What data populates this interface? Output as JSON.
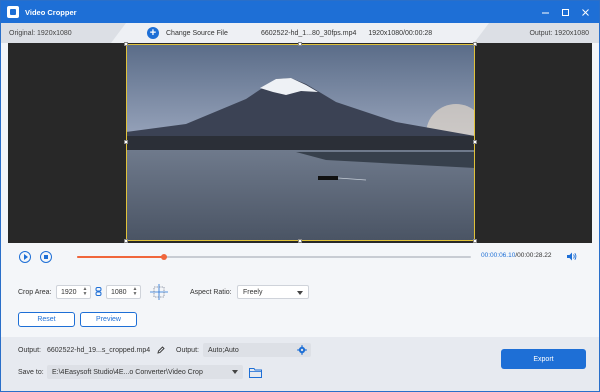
{
  "window": {
    "title": "Video Cropper",
    "controls": [
      "minimize-icon",
      "maximize-icon",
      "close-icon"
    ]
  },
  "info_bar": {
    "original": "Original: 1920x1080",
    "change_source": "Change Source File",
    "filename": "6602522-hd_1...80_30fps.mp4",
    "file_res_duration": "1920x1080/00:00:28",
    "output": "Output: 1920x1080"
  },
  "player": {
    "current_time": "00:00:06.10",
    "total_time": "/00:00:28.22",
    "progress_fraction": 0.22
  },
  "crop": {
    "area_label": "Crop Area:",
    "width": "1920",
    "height": "1080",
    "aspect_label": "Aspect Ratio:",
    "aspect_value": "Freely",
    "reset_label": "Reset",
    "preview_label": "Preview"
  },
  "bottom": {
    "output_label": "Output:",
    "output_file": "6602522-hd_19...s_cropped.mp4",
    "output_label2": "Output:",
    "output_format": "Auto;Auto",
    "save_label": "Save to:",
    "save_path": "E:\\4Easysoft Studio\\4E...o Converter\\Video Crop",
    "export_label": "Export"
  },
  "colors": {
    "accent": "#1e6fd6",
    "progress": "#f0663c",
    "crop_frame": "#e0c23a"
  }
}
